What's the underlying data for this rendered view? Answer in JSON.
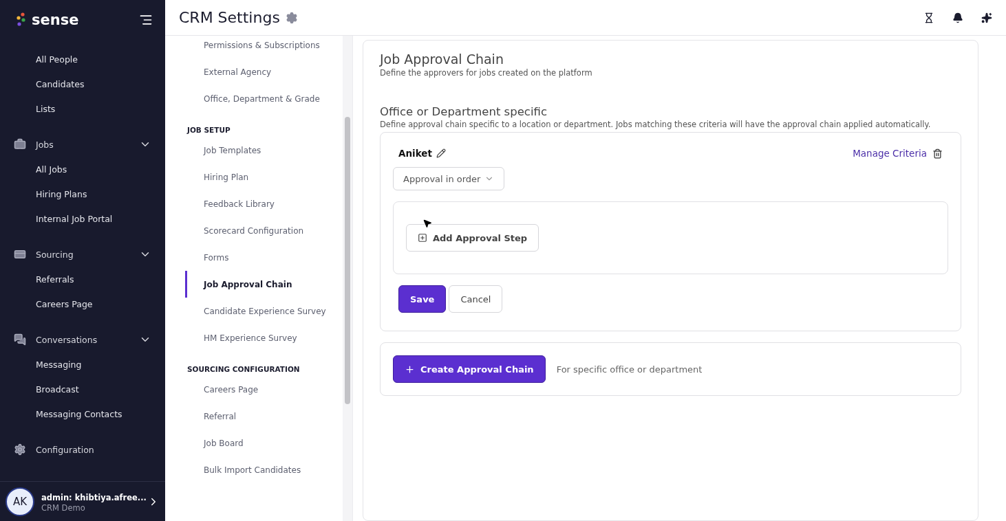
{
  "sidebar": {
    "logo": "sense",
    "groups": [
      {
        "kind": "plain",
        "items": [
          "All People",
          "Candidates",
          "Lists"
        ]
      },
      {
        "kind": "section",
        "label": "Jobs",
        "expanded": true,
        "items": [
          "All Jobs",
          "Hiring Plans",
          "Internal Job Portal"
        ]
      },
      {
        "kind": "section",
        "label": "Sourcing",
        "expanded": true,
        "items": [
          "Referrals",
          "Careers Page"
        ]
      },
      {
        "kind": "section",
        "label": "Conversations",
        "expanded": true,
        "items": [
          "Messaging",
          "Broadcast",
          "Messaging Contacts"
        ]
      },
      {
        "kind": "link",
        "label": "Configuration"
      }
    ],
    "user": {
      "initials": "AK",
      "name": "admin: khibtiya.afree...",
      "org": "CRM Demo"
    }
  },
  "header": {
    "title": "CRM Settings"
  },
  "settings_nav": [
    {
      "kind": "item",
      "label": "Permissions & Subscriptions",
      "selected": false
    },
    {
      "kind": "item",
      "label": "External Agency",
      "selected": false
    },
    {
      "kind": "item",
      "label": "Office, Department & Grade",
      "selected": false
    },
    {
      "kind": "heading",
      "label": "JOB SETUP"
    },
    {
      "kind": "item",
      "label": "Job Templates",
      "selected": false
    },
    {
      "kind": "item",
      "label": "Hiring Plan",
      "selected": false
    },
    {
      "kind": "item",
      "label": "Feedback Library",
      "selected": false
    },
    {
      "kind": "item",
      "label": "Scorecard Configuration",
      "selected": false
    },
    {
      "kind": "item",
      "label": "Forms",
      "selected": false
    },
    {
      "kind": "item",
      "label": "Job Approval Chain",
      "selected": true
    },
    {
      "kind": "item",
      "label": "Candidate Experience Survey",
      "selected": false
    },
    {
      "kind": "item",
      "label": "HM Experience Survey",
      "selected": false
    },
    {
      "kind": "heading",
      "label": "SOURCING CONFIGURATION"
    },
    {
      "kind": "item",
      "label": "Careers Page",
      "selected": false
    },
    {
      "kind": "item",
      "label": "Referral",
      "selected": false
    },
    {
      "kind": "item",
      "label": "Job Board",
      "selected": false
    },
    {
      "kind": "item",
      "label": "Bulk Import Candidates",
      "selected": false
    }
  ],
  "main": {
    "title": "Job Approval Chain",
    "subtitle": "Define the approvers for jobs created on the platform",
    "section_title": "Office or Department specific",
    "section_desc": "Define approval chain specific to a location or department. Jobs matching these criteria will have the approval chain applied automatically.",
    "chain": {
      "name": "Aniket",
      "manage": "Manage Criteria",
      "mode": "Approval in order",
      "add_step": "Add Approval Step",
      "save": "Save",
      "cancel": "Cancel"
    },
    "create": {
      "button": "Create Approval Chain",
      "hint": "For specific office or department"
    }
  }
}
